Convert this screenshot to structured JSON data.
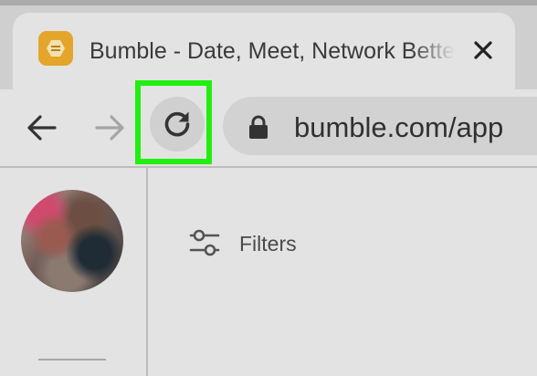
{
  "browser": {
    "tab": {
      "title": "Bumble - Date, Meet, Network Better",
      "favicon": "bumble-hexagon-icon",
      "close_icon": "close-icon"
    },
    "toolbar": {
      "back_icon": "arrow-left-icon",
      "forward_icon": "arrow-right-icon",
      "reload_icon": "reload-icon",
      "highlight_color": "#22ee11",
      "url": "bumble.com/app",
      "lock_icon": "lock-icon"
    }
  },
  "app": {
    "sidebar": {
      "avatar": "profile-avatar"
    },
    "main": {
      "filters_label": "Filters",
      "filters_icon": "sliders-icon"
    }
  },
  "colors": {
    "brand": "#e3a62a",
    "highlight": "#22ee11"
  }
}
